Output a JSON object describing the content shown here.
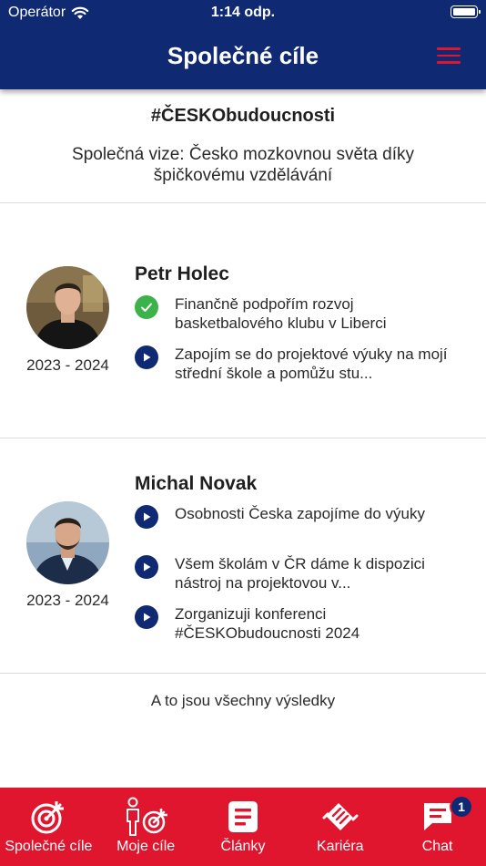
{
  "status_bar": {
    "carrier": "Operátor",
    "time": "1:14 odp."
  },
  "header": {
    "title": "Společné cíle"
  },
  "intro": {
    "hashtag": "#ČESKObudoucnosti",
    "vision": "Společná vize: Česko mozkovnou světa díky špičkovému vzdělávání"
  },
  "people": [
    {
      "name": "Petr Holec",
      "period": "2023 - 2024",
      "goals": [
        {
          "status": "done",
          "icon": "check-icon",
          "text": "Finančně podpořím rozvoj basketbalového klubu v Liberci"
        },
        {
          "status": "in-progress",
          "icon": "play-icon",
          "text": "Zapojím se do projektové výuky na mojí střední škole a pomůžu stu..."
        }
      ]
    },
    {
      "name": "Michal Novak",
      "period": "2023 - 2024",
      "goals": [
        {
          "status": "in-progress",
          "icon": "play-icon",
          "text": "Osobnosti Česka zapojíme do výuky"
        },
        {
          "status": "in-progress",
          "icon": "play-icon",
          "text": "Všem školám v ČR dáme k dispozici nástroj na projektovou v..."
        },
        {
          "status": "in-progress",
          "icon": "play-icon",
          "text": "Zorganizuji konferenci #ČESKObudoucnosti 2024"
        }
      ]
    }
  ],
  "end_message": "A to jsou všechny výsledky",
  "tabbar": {
    "tabs": [
      {
        "label": "Společné cíle",
        "icon": "target-icon",
        "active": true
      },
      {
        "label": "Moje cíle",
        "icon": "person-target-icon",
        "active": false
      },
      {
        "label": "Články",
        "icon": "article-icon",
        "active": false
      },
      {
        "label": "Kariéra",
        "icon": "handshake-icon",
        "active": false
      },
      {
        "label": "Chat",
        "icon": "chat-icon",
        "active": false,
        "badge": "1"
      }
    ]
  },
  "colors": {
    "navy": "#0f2a72",
    "red": "#e0152e",
    "done_green": "#3cb24a"
  }
}
